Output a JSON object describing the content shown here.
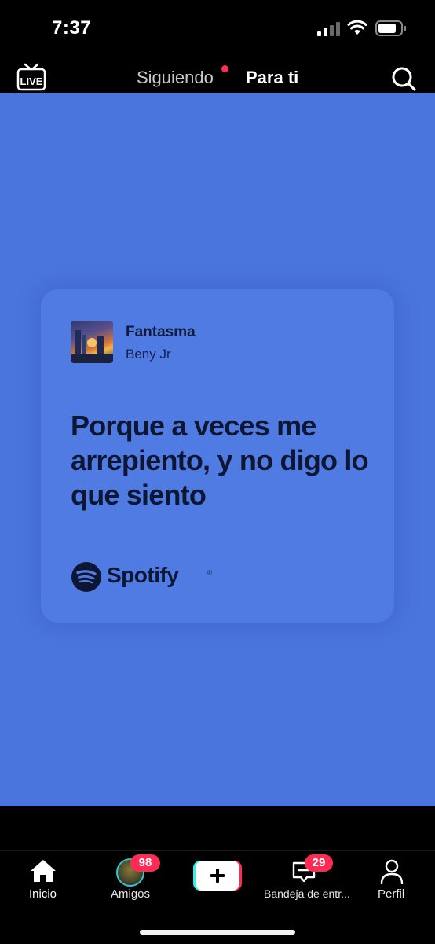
{
  "status_bar": {
    "time": "7:37"
  },
  "top_nav": {
    "live_label": "LIVE",
    "tabs": [
      {
        "label": "Siguiendo",
        "has_dot": true
      },
      {
        "label": "Para ti",
        "active": true
      }
    ]
  },
  "lyric_card": {
    "song_title": "Fantasma",
    "artist": "Beny Jr",
    "lyrics": "Porque a veces me arrepiento, y no digo lo que siento",
    "brand": "Spotify",
    "brand_mark": "®",
    "background_color": "#4a75dd"
  },
  "bottom_nav": {
    "items": [
      {
        "label": "Inicio",
        "icon": "home-icon"
      },
      {
        "label": "Amigos",
        "icon": "avatar",
        "badge": "98"
      },
      {
        "label": "",
        "icon": "plus-icon"
      },
      {
        "label": "Bandeja de entr...",
        "icon": "inbox-icon",
        "badge": "29"
      },
      {
        "label": "Perfil",
        "icon": "profile-icon"
      }
    ]
  },
  "colors": {
    "accent": "#fe2c55",
    "cyan": "#25f4ee"
  }
}
